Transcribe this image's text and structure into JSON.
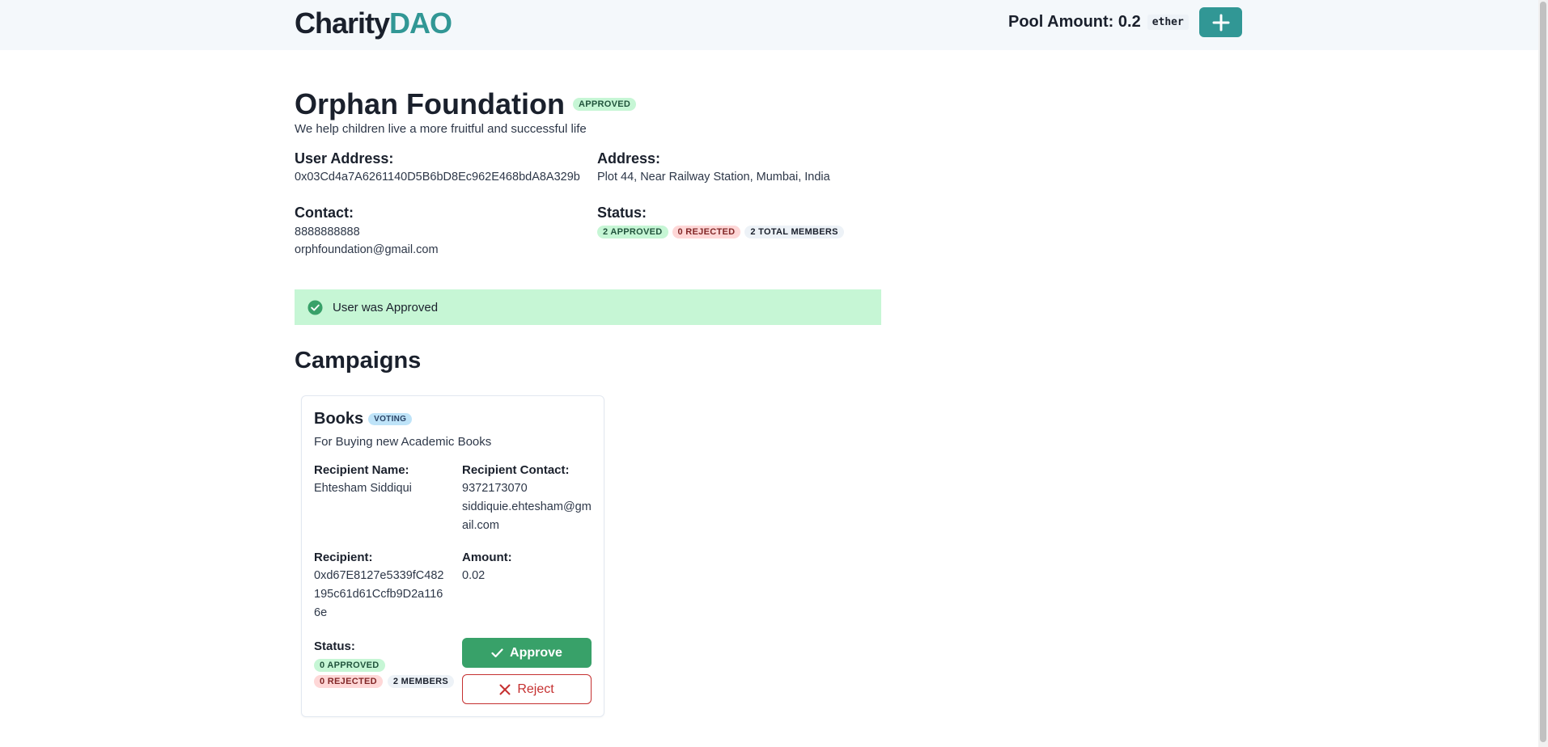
{
  "header": {
    "logo_part1": "Charity",
    "logo_part2": "DAO",
    "pool_label": "Pool Amount: 0.2",
    "pool_unit": "ether",
    "add_icon": "plus-icon"
  },
  "org": {
    "name": "Orphan Foundation",
    "status_badge": "APPROVED",
    "tagline": "We help children live a more fruitful and successful life",
    "user_address_label": "User Address:",
    "user_address": "0x03Cd4a7A6261140D5B6bD8Ec962E468bdA8A329b",
    "address_label": "Address:",
    "address": "Plot 44, Near Railway Station, Mumbai, India",
    "contact_label": "Contact:",
    "phone": "8888888888",
    "email": "orphfoundation@gmail.com",
    "status_label": "Status:",
    "approved_badge": "2 APPROVED",
    "rejected_badge": "0 REJECTED",
    "members_badge": "2 TOTAL MEMBERS"
  },
  "alert": {
    "message": "User was Approved",
    "icon": "check-circle-icon",
    "color": "#c6f6d5"
  },
  "campaigns": {
    "heading": "Campaigns",
    "items": [
      {
        "title": "Books",
        "badge": "VOTING",
        "description": "For Buying new Academic Books",
        "recipient_name_label": "Recipient Name:",
        "recipient_name": "Ehtesham Siddiqui",
        "recipient_contact_label": "Recipient Contact:",
        "recipient_phone": "9372173070",
        "recipient_email": "siddiquie.ehtesham@gmail.com",
        "recipient_label": "Recipient:",
        "recipient": "0xd67E8127e5339fC482195c61d61Ccfb9D2a1166e",
        "amount_label": "Amount:",
        "amount": "0.02",
        "status_label": "Status:",
        "approved_badge": "0 APPROVED",
        "rejected_badge": "0 REJECTED",
        "members_badge": "2 MEMBERS",
        "approve_label": "Approve",
        "reject_label": "Reject"
      }
    ]
  },
  "colors": {
    "brand": "#319795",
    "approve": "#38a169",
    "reject": "#c53030"
  }
}
